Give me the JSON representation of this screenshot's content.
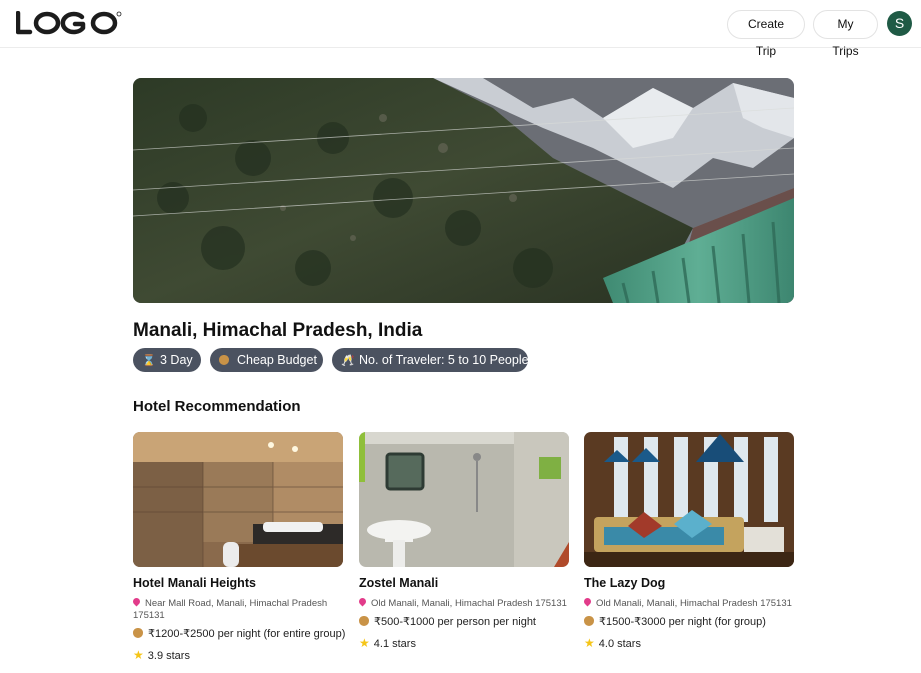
{
  "header": {
    "logo_text": "LOGO",
    "create_trip_label": "Create Trip",
    "my_trips_label": "My Trips",
    "avatar_initial": "S"
  },
  "trip": {
    "destination": "Manali, Himachal Pradesh, India",
    "chips": [
      {
        "icon": "hourglass-icon",
        "label": "3 Day"
      },
      {
        "icon": "money-bag-icon",
        "label": "Cheap Budget"
      },
      {
        "icon": "glasses-clink-icon",
        "label": "No. of Traveler: 5 to 10 People"
      }
    ]
  },
  "hotels_section": {
    "title": "Hotel Recommendation",
    "hotels": [
      {
        "name": "Hotel Manali Heights",
        "address": "Near Mall Road, Manali, Himachal Pradesh 175131",
        "price": "₹1200-₹2500 per night (for entire group)",
        "rating": "3.9 stars"
      },
      {
        "name": "Zostel Manali",
        "address": "Old Manali, Manali, Himachal Pradesh 175131",
        "price": "₹500-₹1000 per person per night",
        "rating": "4.1 stars"
      },
      {
        "name": "The Lazy Dog",
        "address": "Old Manali, Manali, Himachal Pradesh 175131",
        "price": "₹1500-₹3000 per night (for group)",
        "rating": "4.0 stars"
      }
    ]
  },
  "colors": {
    "chip_bg": "#4b5260",
    "avatar_bg": "#1f5a45",
    "pin": "#e23b8a",
    "star": "#f5c518"
  }
}
